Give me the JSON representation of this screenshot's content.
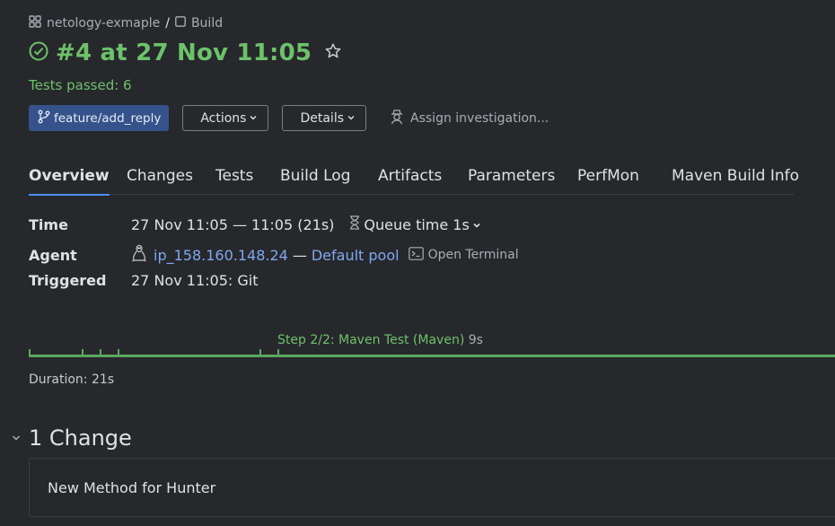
{
  "breadcrumb": {
    "project": "netology-exmaple",
    "separator": "/",
    "build_config": "Build"
  },
  "header": {
    "title": "#4 at 27 Nov 11:05",
    "status": "Tests passed: 6"
  },
  "actions": {
    "branch": "feature/add_reply",
    "actions_label": "Actions",
    "details_label": "Details",
    "assign_label": "Assign investigation..."
  },
  "tabs": [
    {
      "label": "Overview",
      "active": true
    },
    {
      "label": "Changes"
    },
    {
      "label": "Tests"
    },
    {
      "label": "Build Log"
    },
    {
      "label": "Artifacts"
    },
    {
      "label": "Parameters"
    },
    {
      "label": "PerfMon"
    },
    {
      "label": "Maven Build Info"
    }
  ],
  "overview": {
    "time_label": "Time",
    "time_value": "27 Nov 11:05 — 11:05 (21s)",
    "queue_time": "Queue time 1s",
    "agent_label": "Agent",
    "agent_name": "ip_158.160.148.24",
    "agent_sep": "—",
    "agent_pool": "Default pool",
    "open_terminal": "Open Terminal",
    "triggered_label": "Triggered",
    "triggered_value": "27 Nov 11:05: Git"
  },
  "timeline": {
    "step_label": "Step 2/2: Maven Test (Maven)",
    "step_duration": "9s",
    "duration": "Duration: 21s"
  },
  "changes": {
    "heading": "1 Change",
    "items": [
      {
        "message": "New Method for Hunter"
      }
    ]
  },
  "colors": {
    "success": "#6cc26a",
    "link": "#7fa8f0",
    "accent": "#4d8ff0",
    "branch_bg": "#35538a",
    "background": "#27282c"
  },
  "icons": [
    "project-icon",
    "build-config-icon",
    "success-circle-icon",
    "star-icon",
    "branch-icon",
    "chevron-down-icon",
    "investigator-icon",
    "hourglass-icon",
    "linux-icon",
    "terminal-icon"
  ]
}
